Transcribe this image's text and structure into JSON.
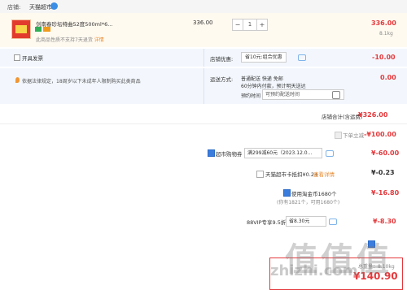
{
  "store": {
    "label": "店铺:",
    "name": "天猫超市",
    "icon": "store-badge-icon"
  },
  "product": {
    "title": "剑南春珍坛特曲52度500ml*6...",
    "note_prefix": "此商品性质不支持7天退货",
    "note_link": "详情",
    "unit_price": "336.00",
    "quantity": "1",
    "decrement": "−",
    "increment": "+",
    "line_total": "336.00",
    "weight": "8.1kg"
  },
  "invoice": {
    "label": "开具发票"
  },
  "store_coupon": {
    "label": "店铺优惠:",
    "selected": "省10元:组合优惠",
    "amount": "-10.00"
  },
  "tip": {
    "text": "依据法律规定，18周岁以下未成年人限制购买此类商品"
  },
  "shipping": {
    "label": "运送方式:",
    "method": "普通配送 快递 免邮",
    "note": "60分钟内付款，预计明天送达",
    "amount": "0.00",
    "time_label": "预约时间",
    "time_placeholder": "可预约配送时间"
  },
  "store_total": {
    "label": "店铺合计(含运费)",
    "value": "¥326.00"
  },
  "discounts": {
    "instant": {
      "label": "下单立减",
      "value": "-¥100.00"
    },
    "voucher": {
      "label": "超市购物券",
      "selected": "满299减60元（2023.12.0...",
      "value": "¥-60.00"
    },
    "card": {
      "label": "天猫超市卡抵扣¥0.23",
      "link": "查看详情",
      "value": "¥-0.23"
    },
    "points": {
      "label": "使用淘金币1680个",
      "sub": "(你有1821个，可用1680个)",
      "value": "¥-16.80"
    },
    "vip": {
      "label": "88VIP专享9.5折",
      "selected": "省8.30元",
      "value": "¥-8.30"
    }
  },
  "summary": {
    "weight": "总重量：8.10kg",
    "total": "¥140.90"
  },
  "watermark": {
    "cn": "值值值",
    "url": "zhizhi.com"
  },
  "colors": {
    "accent": "#e4393c",
    "info_blue": "#3b7ddd",
    "row_bg": "#f3f7fd"
  }
}
